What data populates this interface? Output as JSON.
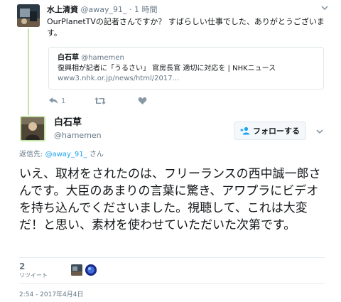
{
  "parent_tweet": {
    "name": "水上清資",
    "handle": "@away_91_",
    "separator": "·",
    "time": "1 時間",
    "text": "OurPlanetTVの記者さんですか？ すばらしい仕事でした、ありがとうございます。",
    "quoted": {
      "name": "白石草",
      "handle": "@hamemen",
      "title": "復興相が記者に「うるさい」 官房長官 適切に対応を | NHKニュース",
      "url": "www3.nhk.or.jp/news/html/2017..."
    },
    "actions": {
      "reply_count": "1"
    }
  },
  "main_tweet": {
    "name": "白石草",
    "handle": "@hamemen",
    "follow_label": "フォローする",
    "replying_prefix": "返信先:",
    "replying_to": "@away_91_",
    "replying_suffix": "さん",
    "text": "いえ、取材をされたのは、フリーランスの西中誠一郎さんです。大臣のあまりの言葉に驚き、アワプラにビデオを持ち込んでくださいました。視聴して、これは大変だ！と思い、素材を使わせていただいた次第です。",
    "retweet_count": "2",
    "retweet_label": "リツイート",
    "timestamp": "2:54 - 2017年4月4日"
  },
  "colors": {
    "thread_line": "#c3e5a8",
    "link_blue": "#1da1f2",
    "muted_gray": "#657786"
  },
  "icons": [
    "chevron-down-icon",
    "reply-icon",
    "retweet-icon",
    "like-icon",
    "follow-person-plus-icon"
  ]
}
